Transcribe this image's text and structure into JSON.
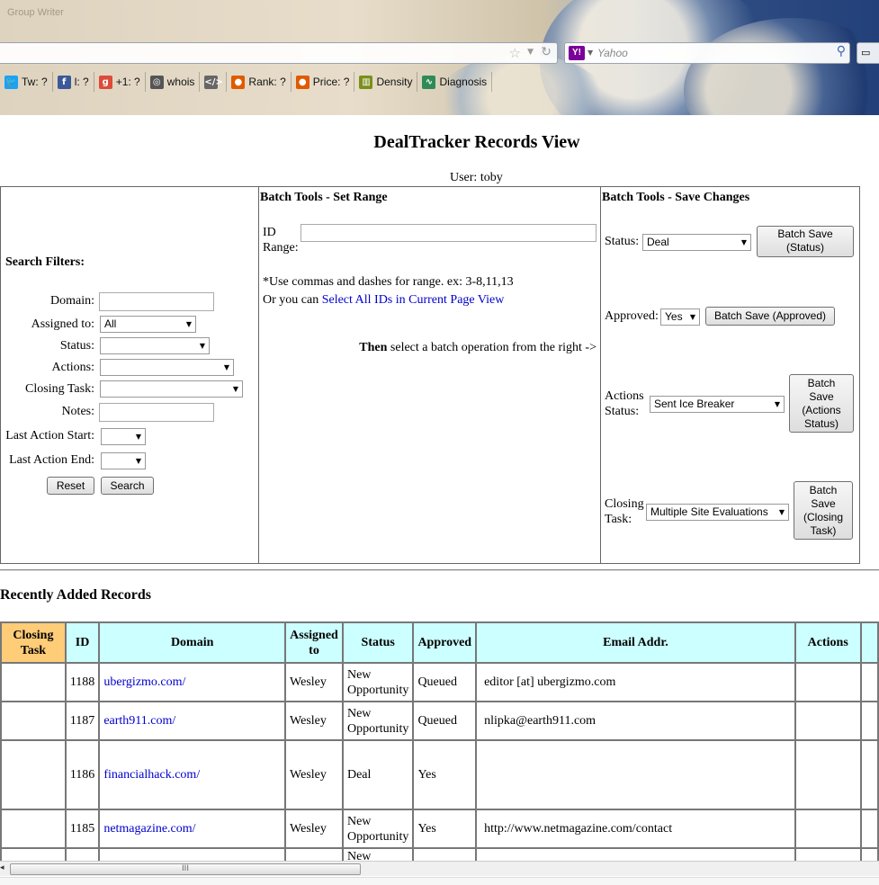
{
  "browser": {
    "tab_title": "Group Writer",
    "search_placeholder": "Yahoo",
    "search_engine_icon": "Y!",
    "toolbar": [
      {
        "label": "Tw: ?",
        "icon": "twitter-icon",
        "color": "#1da1f2",
        "glyph": "🐦"
      },
      {
        "label": "l: ?",
        "icon": "facebook-icon",
        "color": "#3b5998",
        "glyph": "f"
      },
      {
        "label": "+1: ?",
        "icon": "google-plus-icon",
        "color": "#dd4b39",
        "glyph": "g"
      },
      {
        "label": "whois",
        "icon": "fingerprint-icon",
        "color": "#555555",
        "glyph": "◎"
      },
      {
        "label": "",
        "icon": "source-code-icon",
        "color": "#666666",
        "glyph": "</>"
      },
      {
        "label": "Rank: ?",
        "icon": "rank-icon",
        "color": "#e05a00",
        "glyph": "●"
      },
      {
        "label": "Price: ?",
        "icon": "price-icon",
        "color": "#e05a00",
        "glyph": "●"
      },
      {
        "label": "Density",
        "icon": "density-chart-icon",
        "color": "#7a8f1c",
        "glyph": "▥"
      },
      {
        "label": "Diagnosis",
        "icon": "diagnosis-icon",
        "color": "#2e8b57",
        "glyph": "∿"
      }
    ]
  },
  "page": {
    "title": "DealTracker Records View",
    "user_line": "User: toby"
  },
  "filters": {
    "heading": "Search Filters:",
    "domain_label": "Domain:",
    "assigned_label": "Assigned to:",
    "assigned_value": "All",
    "status_label": "Status:",
    "actions_label": "Actions:",
    "closing_label": "Closing Task:",
    "notes_label": "Notes:",
    "last_start_label": "Last Action Start:",
    "last_end_label": "Last Action End:",
    "reset_label": "Reset",
    "search_label": "Search"
  },
  "batch_range": {
    "heading": "Batch Tools - Set Range",
    "id_label_1": "ID",
    "id_label_2": "Range:",
    "hint": "*Use commas and dashes for range. ex: 3-8,11,13",
    "or_text": "Or you can ",
    "select_all_link": "Select All IDs in Current Page View",
    "then_bold": "Then",
    "then_rest": " select a batch operation from the right ->"
  },
  "batch_save": {
    "heading": "Batch Tools - Save Changes",
    "status_label": "Status:",
    "status_value": "Deal",
    "status_btn_1": "Batch Save",
    "status_btn_2": "(Status)",
    "approved_label": "Approved:",
    "approved_value": "Yes",
    "approved_btn": "Batch Save (Approved)",
    "actions_label_1": "Actions",
    "actions_label_2": "Status:",
    "actions_value": "Sent Ice Breaker",
    "actions_btn": [
      "Batch",
      "Save",
      "(Actions",
      "Status)"
    ],
    "closing_label_1": "Closing",
    "closing_label_2": "Task:",
    "closing_value": "Multiple Site Evaluations",
    "closing_btn": [
      "Batch",
      "Save",
      "(Closing",
      "Task)"
    ]
  },
  "records": {
    "heading": "Recently Added Records",
    "columns": [
      "Closing Task",
      "ID",
      "Domain",
      "Assigned to",
      "Status",
      "Approved",
      "Email Addr.",
      "Actions"
    ],
    "rows": [
      {
        "closing": "",
        "id": "1188",
        "domain": "ubergizmo.com/",
        "assigned": "Wesley",
        "status": "New Opportunity",
        "approved": "Queued",
        "email": "editor [at] ubergizmo.com",
        "actions": ""
      },
      {
        "closing": "",
        "id": "1187",
        "domain": "earth911.com/",
        "assigned": "Wesley",
        "status": "New Opportunity",
        "approved": "Queued",
        "email": "nlipka@earth911.com",
        "actions": ""
      },
      {
        "closing": "",
        "id": "1186",
        "domain": "financialhack.com/",
        "assigned": "Wesley",
        "status": "Deal",
        "approved": "Yes",
        "email": "",
        "actions": ""
      },
      {
        "closing": "",
        "id": "1185",
        "domain": "netmagazine.com/",
        "assigned": "Wesley",
        "status": "New Opportunity",
        "approved": "Yes",
        "email": "http://www.netmagazine.com/contact",
        "actions": ""
      },
      {
        "closing": "",
        "id": "",
        "domain": "",
        "assigned": "",
        "status": "New",
        "approved": "",
        "email": "",
        "actions": ""
      }
    ]
  },
  "scrollbar": {
    "grip": "III"
  }
}
